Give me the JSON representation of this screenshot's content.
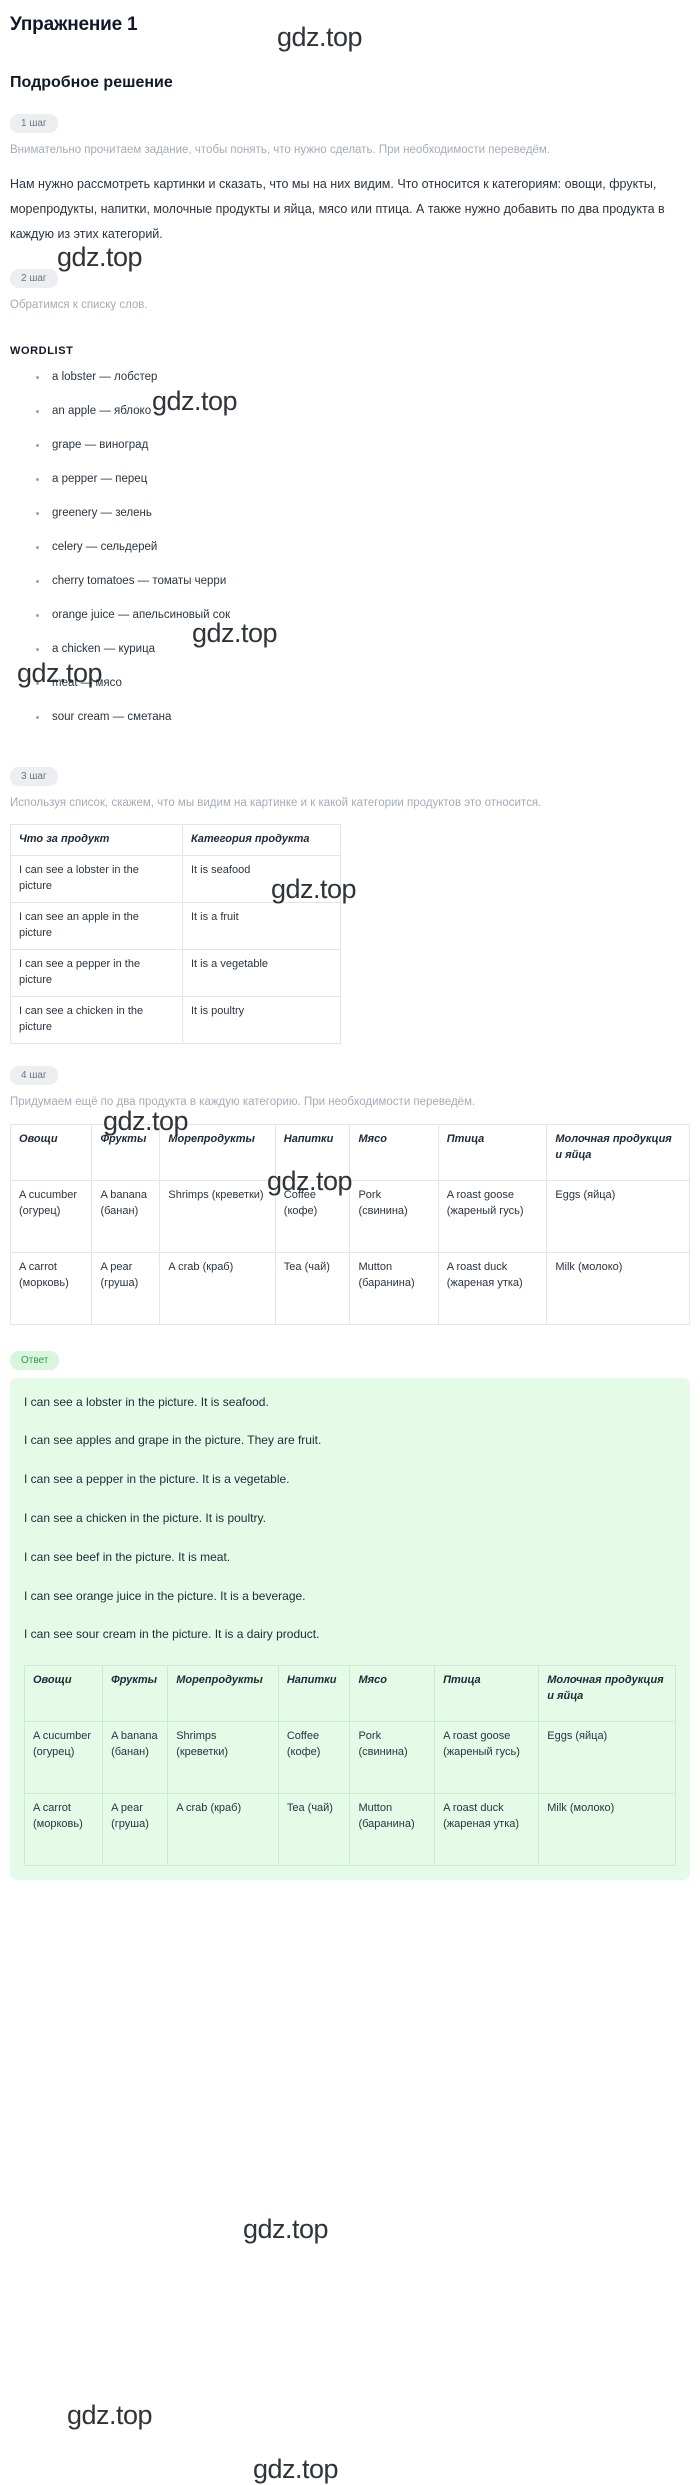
{
  "title": "Упражнение 1",
  "solution_heading": "Подробное решение",
  "watermark": "gdz.top",
  "steps": {
    "step1_badge": "1 шаг",
    "step1_note": "Внимательно прочитаем задание, чтобы понять, что нужно сделать. При необходимости переведём.",
    "step1_body": "Нам нужно рассмотреть картинки и сказать, что мы на них видим. Что относится к категориям: овощи, фрукты, морепродукты, напитки, молочные продукты и яйца, мясо или птица. А также нужно добавить по два продукта в каждую из этих категорий.",
    "step2_badge": "2 шаг",
    "step2_note": "Обратимся к списку слов.",
    "step3_badge": "3 шаг",
    "step3_note": "Используя список, скажем, что мы видим на картинке и к какой категории продуктов это относится.",
    "step4_badge": "4 шаг",
    "step4_note": "Придумаем ещё по два продукта в каждую категорию. При необходимости переведём."
  },
  "wordlist_title": "WORDLIST",
  "wordlist": [
    "a lobster — лобстер",
    "an apple — яблоко",
    "grape — виноград",
    "a pepper — перец",
    "greenery — зелень",
    "celery — сельдерей",
    "cherry tomatoes — томаты черри",
    "orange juice — апельсиновый сок",
    "a chicken — курица",
    "meat — мясо",
    "sour cream — сметана"
  ],
  "table1": {
    "headers": [
      "Что за продукт",
      "Категория продукта"
    ],
    "rows": [
      [
        "I can see a lobster in the picture",
        "It is seafood"
      ],
      [
        "I can see an apple in the picture",
        "It is a fruit"
      ],
      [
        "I can see a pepper in the picture",
        "It is a vegetable"
      ],
      [
        "I can see a chicken in the picture",
        "It is poultry"
      ]
    ]
  },
  "table2": {
    "headers": [
      "Овощи",
      "Фрукты",
      "Морепродукты",
      "Напитки",
      "Мясо",
      "Птица",
      "Молочная продукция и яйца"
    ],
    "rows": [
      [
        "A cucumber (огурец)",
        "A banana (банан)",
        "Shrimps (креветки)",
        "Coffee (кофе)",
        "Pork (свинина)",
        "A roast goose (жареный гусь)",
        "Eggs (яйца)"
      ],
      [
        "A carrot (морковь)",
        "A pear (груша)",
        "A crab (краб)",
        "Tea (чай)",
        "Mutton (баранина)",
        "A roast duck (жареная утка)",
        "Milk (молоко)"
      ]
    ]
  },
  "answer": {
    "badge": "Ответ",
    "lines": [
      "I can see a lobster in the picture. It is seafood.",
      "I can see apples and grape in the picture. They are fruit.",
      "I can see a pepper in the picture. It is a vegetable.",
      "I can see a chicken in the picture. It is poultry.",
      "I can see beef in the picture. It is meat.",
      "I can see orange juice in the picture. It is a beverage.",
      "I can see sour cream in the picture. It is a dairy product."
    ],
    "table": {
      "headers": [
        "Овощи",
        "Фрукты",
        "Морепродукты",
        "Напитки",
        "Мясо",
        "Птица",
        "Молочная продукция и яйца"
      ],
      "rows": [
        [
          "A cucumber (огурец)",
          "A banana (банан)",
          "Shrimps (креветки)",
          "Coffee (кофе)",
          "Pork (свинина)",
          "A roast goose (жареный гусь)",
          "Eggs (яйца)"
        ],
        [
          "A carrot (морковь)",
          "A pear (груша)",
          "A crab (краб)",
          "Tea (чай)",
          "Mutton (баранина)",
          "A roast duck (жареная утка)",
          "Milk (молоко)"
        ]
      ]
    }
  }
}
